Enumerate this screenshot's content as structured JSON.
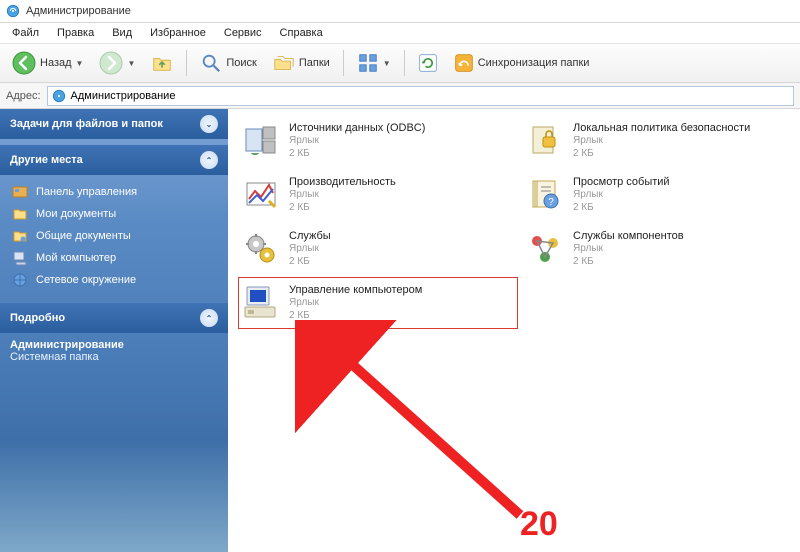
{
  "window": {
    "title": "Администрирование"
  },
  "menu": {
    "file": "Файл",
    "edit": "Правка",
    "view": "Вид",
    "favorites": "Избранное",
    "tools": "Сервис",
    "help": "Справка"
  },
  "toolbar": {
    "back": "Назад",
    "search": "Поиск",
    "folders": "Папки",
    "sync": "Синхронизация папки"
  },
  "address": {
    "label": "Адрес:",
    "value": "Администрирование"
  },
  "sidebar": {
    "tasks_header": "Задачи для файлов и папок",
    "places_header": "Другие места",
    "places": [
      {
        "label": "Панель управления"
      },
      {
        "label": "Мои документы"
      },
      {
        "label": "Общие документы"
      },
      {
        "label": "Мой компьютер"
      },
      {
        "label": "Сетевое окружение"
      }
    ],
    "details_header": "Подробно",
    "details": {
      "title": "Администрирование",
      "type": "Системная папка"
    }
  },
  "files": {
    "type_label": "Ярлык",
    "size_label": "2 КБ",
    "items": [
      {
        "name": "Источники данных (ODBC)"
      },
      {
        "name": "Локальная политика безопасности"
      },
      {
        "name": "Производительность"
      },
      {
        "name": "Просмотр событий"
      },
      {
        "name": "Службы"
      },
      {
        "name": "Службы компонентов"
      },
      {
        "name": "Управление компьютером"
      }
    ]
  },
  "annotation": {
    "number": "20"
  },
  "colors": {
    "highlight": "#d93a2e",
    "sidebar_top": "#3f73b5"
  }
}
